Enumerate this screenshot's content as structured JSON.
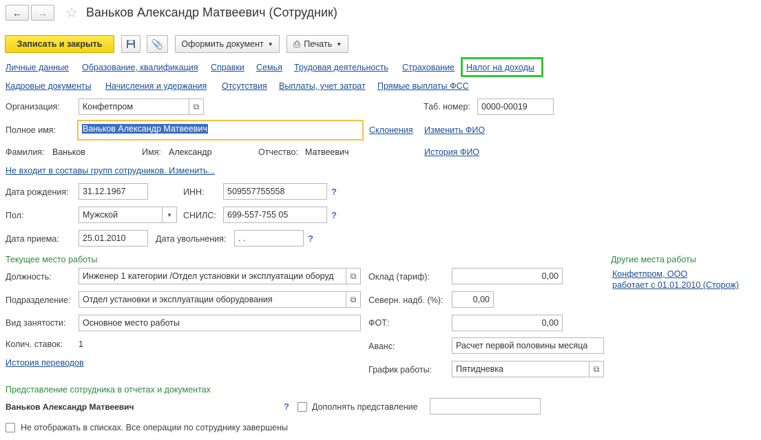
{
  "window": {
    "title": "Ваньков Александр Матвеевич (Сотрудник)"
  },
  "toolbar": {
    "save_close": "Записать и закрыть",
    "create_doc": "Оформить документ",
    "print": "Печать"
  },
  "nav_row1": [
    "Личные данные",
    "Образование, квалификация",
    "Справки",
    "Семья",
    "Трудовая деятельность",
    "Страхование",
    "Налог на доходы"
  ],
  "nav_row2": [
    "Кадровые документы",
    "Начисления и удержания",
    "Отсутствия",
    "Выплаты, учет затрат",
    "Прямые выплаты ФСС"
  ],
  "form": {
    "org_label": "Организация:",
    "org_value": "Конфетпром",
    "tab_label": "Таб. номер:",
    "tab_value": "0000-00019",
    "fullname_label": "Полное имя:",
    "fullname_value": "Ваньков Александр Матвеевич",
    "declensions": "Склонения",
    "change_fio": "Изменить ФИО",
    "history_fio": "История ФИО",
    "lastname_label": "Фамилия:",
    "lastname_value": "Ваньков",
    "firstname_label": "Имя:",
    "firstname_value": "Александр",
    "middlename_label": "Отчество:",
    "middlename_value": "Матвеевич",
    "groups_link": "Не входит в составы групп сотрудников. Изменить...",
    "birth_label": "Дата рождения:",
    "birth_value": "31.12.1967",
    "inn_label": "ИНН:",
    "inn_value": "509557755558",
    "sex_label": "Пол:",
    "sex_value": "Мужской",
    "snils_label": "СНИЛС:",
    "snils_value": "699-557-755 05",
    "hire_label": "Дата приема:",
    "hire_value": "25.01.2010",
    "fire_label": "Дата увольнения:",
    "fire_value": " .  .",
    "help": "?"
  },
  "work": {
    "section_title": "Текущее место работы",
    "other_title": "Другие места работы",
    "other_link1": "Конфетпром, ООО",
    "other_link2": "работает с 01.01.2010 (Сторож)",
    "position_label": "Должность:",
    "position_value": "Инженер 1 категории /Отдел установки и эксплуатации оборуд",
    "dept_label": "Подразделение:",
    "dept_value": "Отдел установки и эксплуатации оборудования",
    "emptype_label": "Вид занятости:",
    "emptype_value": "Основное место работы",
    "rates_label": "Колич. ставок:",
    "rates_value": "1",
    "history_link": "История переводов",
    "salary_label": "Оклад (тариф):",
    "salary_value": "0,00",
    "north_label": "Северн. надб. (%):",
    "north_value": "0,00",
    "fot_label": "ФОТ:",
    "fot_value": "0,00",
    "advance_label": "Аванс:",
    "advance_value": "Расчет первой половины месяца",
    "schedule_label": "График работы:",
    "schedule_value": "Пятидневка"
  },
  "representation": {
    "title": "Представление сотрудника в отчетах и документах",
    "name": "Ваньков Александр Матвеевич",
    "help": "?",
    "supplement_label": "Дополнять представление",
    "supplement_value": ""
  },
  "footer": {
    "hide_label": "Не отображать в списках. Все операции по сотруднику завершены"
  }
}
